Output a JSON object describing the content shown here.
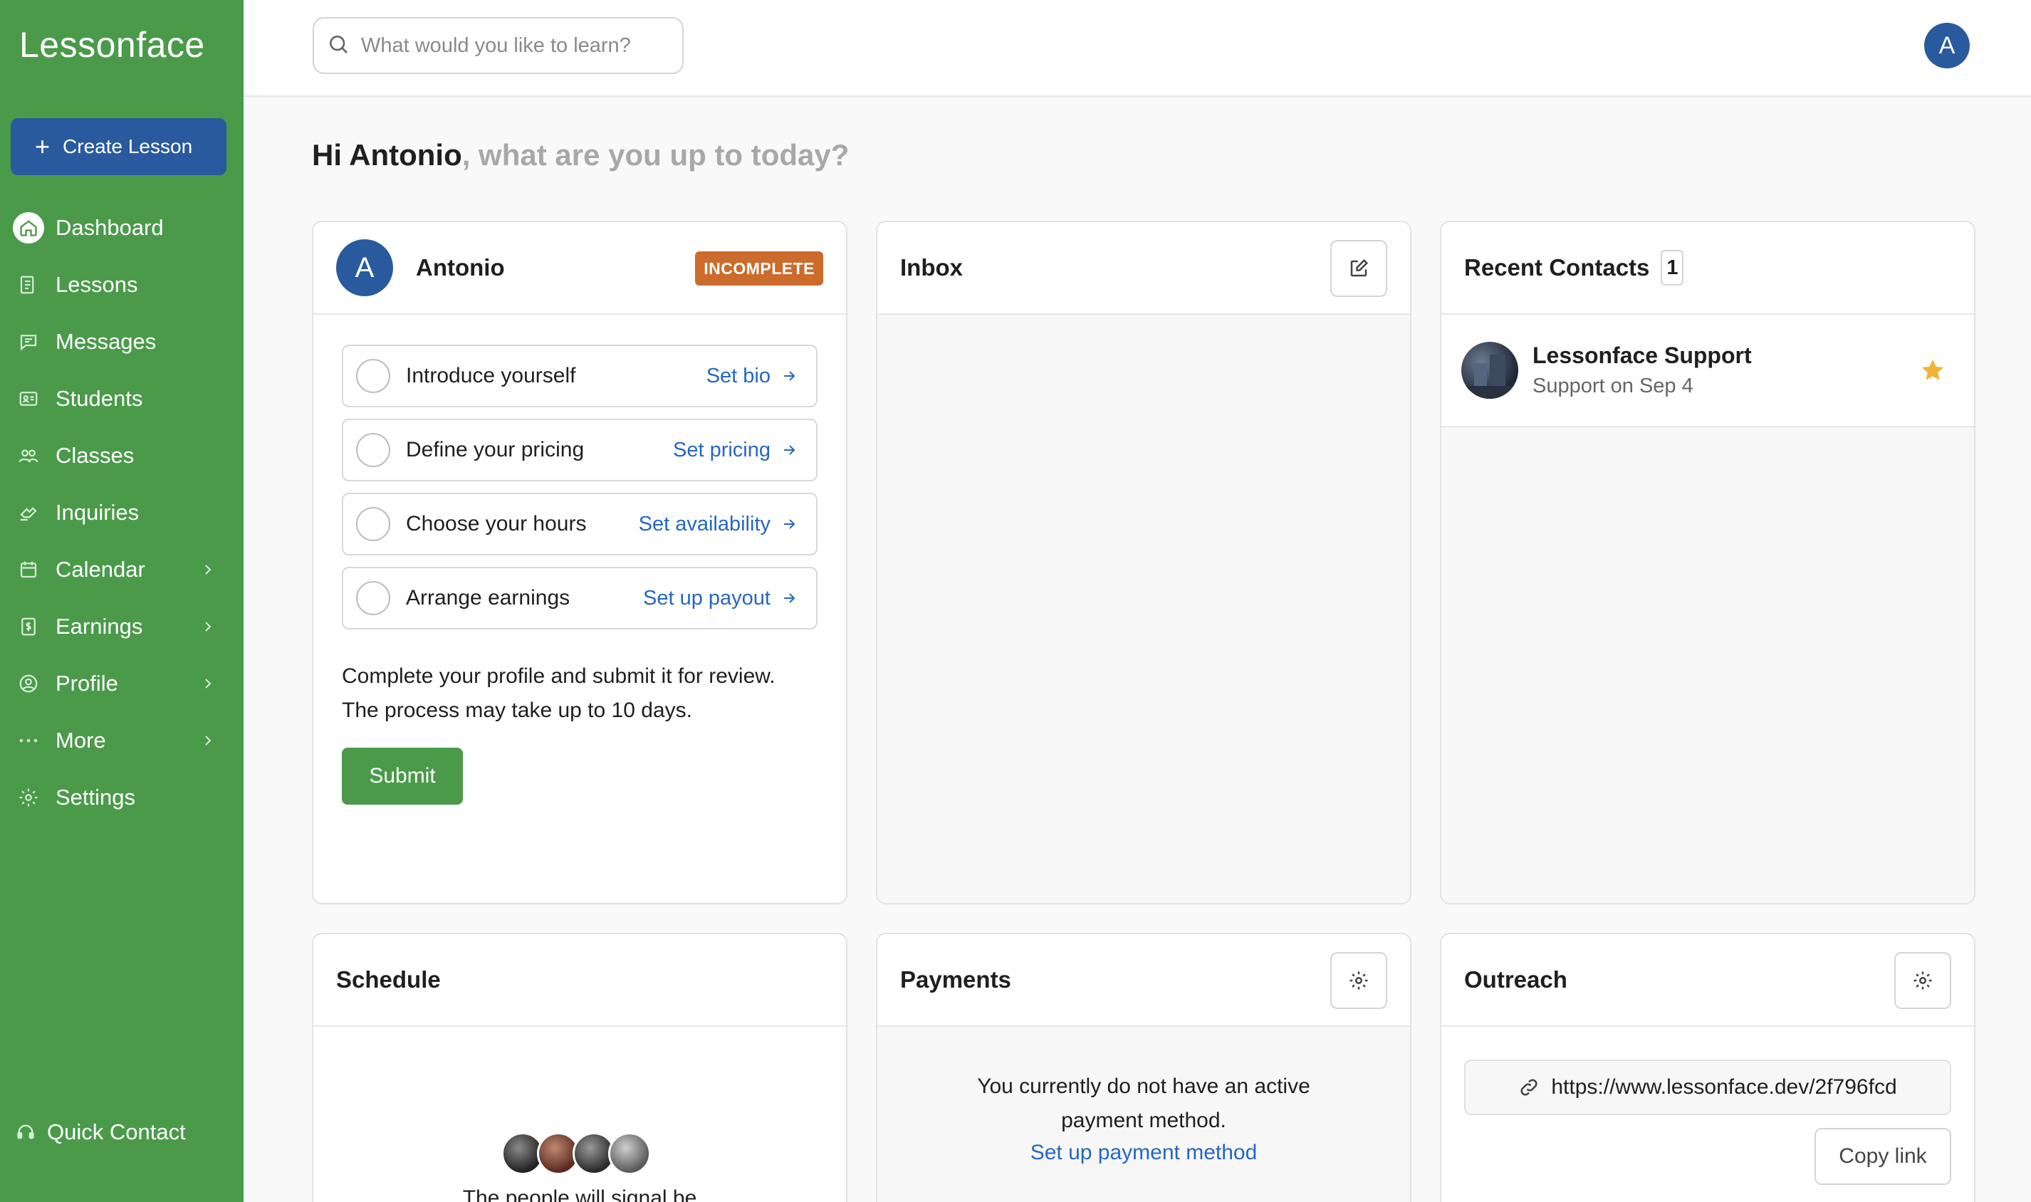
{
  "app": {
    "logo": "Lessonface"
  },
  "sidebar": {
    "create_label": "Create Lesson",
    "items": [
      {
        "label": "Dashboard",
        "icon": "home-icon",
        "active": true
      },
      {
        "label": "Lessons",
        "icon": "lessons-icon"
      },
      {
        "label": "Messages",
        "icon": "chat-icon"
      },
      {
        "label": "Students",
        "icon": "id-card-icon"
      },
      {
        "label": "Classes",
        "icon": "group-icon"
      },
      {
        "label": "Inquiries",
        "icon": "hand-icon"
      },
      {
        "label": "Calendar",
        "icon": "calendar-icon",
        "expandable": true
      },
      {
        "label": "Earnings",
        "icon": "dollar-icon",
        "expandable": true
      },
      {
        "label": "Profile",
        "icon": "user-circle-icon",
        "expandable": true
      },
      {
        "label": "More",
        "icon": "dots-icon",
        "expandable": true
      },
      {
        "label": "Settings",
        "icon": "gear-icon"
      }
    ],
    "quick_contact": "Quick Contact"
  },
  "header": {
    "search_placeholder": "What would you like to learn?",
    "avatar_initial": "A"
  },
  "greeting": {
    "name": "Hi Antonio",
    "rest": ", what are you up to today?"
  },
  "profile_card": {
    "avatar_initial": "A",
    "name": "Antonio",
    "status": "INCOMPLETE",
    "tasks": [
      {
        "label": "Introduce yourself",
        "link": "Set bio"
      },
      {
        "label": "Define your pricing",
        "link": "Set pricing"
      },
      {
        "label": "Choose your hours",
        "link": "Set availability"
      },
      {
        "label": "Arrange earnings",
        "link": "Set up payout"
      }
    ],
    "note_line1": "Complete your profile and submit it for review.",
    "note_line2": "The process may take up to 10 days.",
    "submit_label": "Submit"
  },
  "inbox": {
    "title": "Inbox"
  },
  "recent_contacts": {
    "title": "Recent Contacts",
    "count": "1",
    "contacts": [
      {
        "name": "Lessonface Support",
        "sub": "Support on Sep 4",
        "starred": true
      }
    ]
  },
  "schedule": {
    "title": "Schedule",
    "text": "The people will signal be"
  },
  "payments": {
    "title": "Payments",
    "text_line1": "You currently do not have an active",
    "text_line2": "payment method.",
    "link": "Set up payment method"
  },
  "outreach": {
    "title": "Outreach",
    "url": "https://www.lessonface.dev/2f796fcd",
    "copy_label": "Copy link"
  },
  "colors": {
    "sidebar": "#4a9a4a",
    "primary": "#2a5a9e",
    "badge": "#cc6b2c",
    "link": "#2567c4",
    "star": "#f2b233"
  }
}
